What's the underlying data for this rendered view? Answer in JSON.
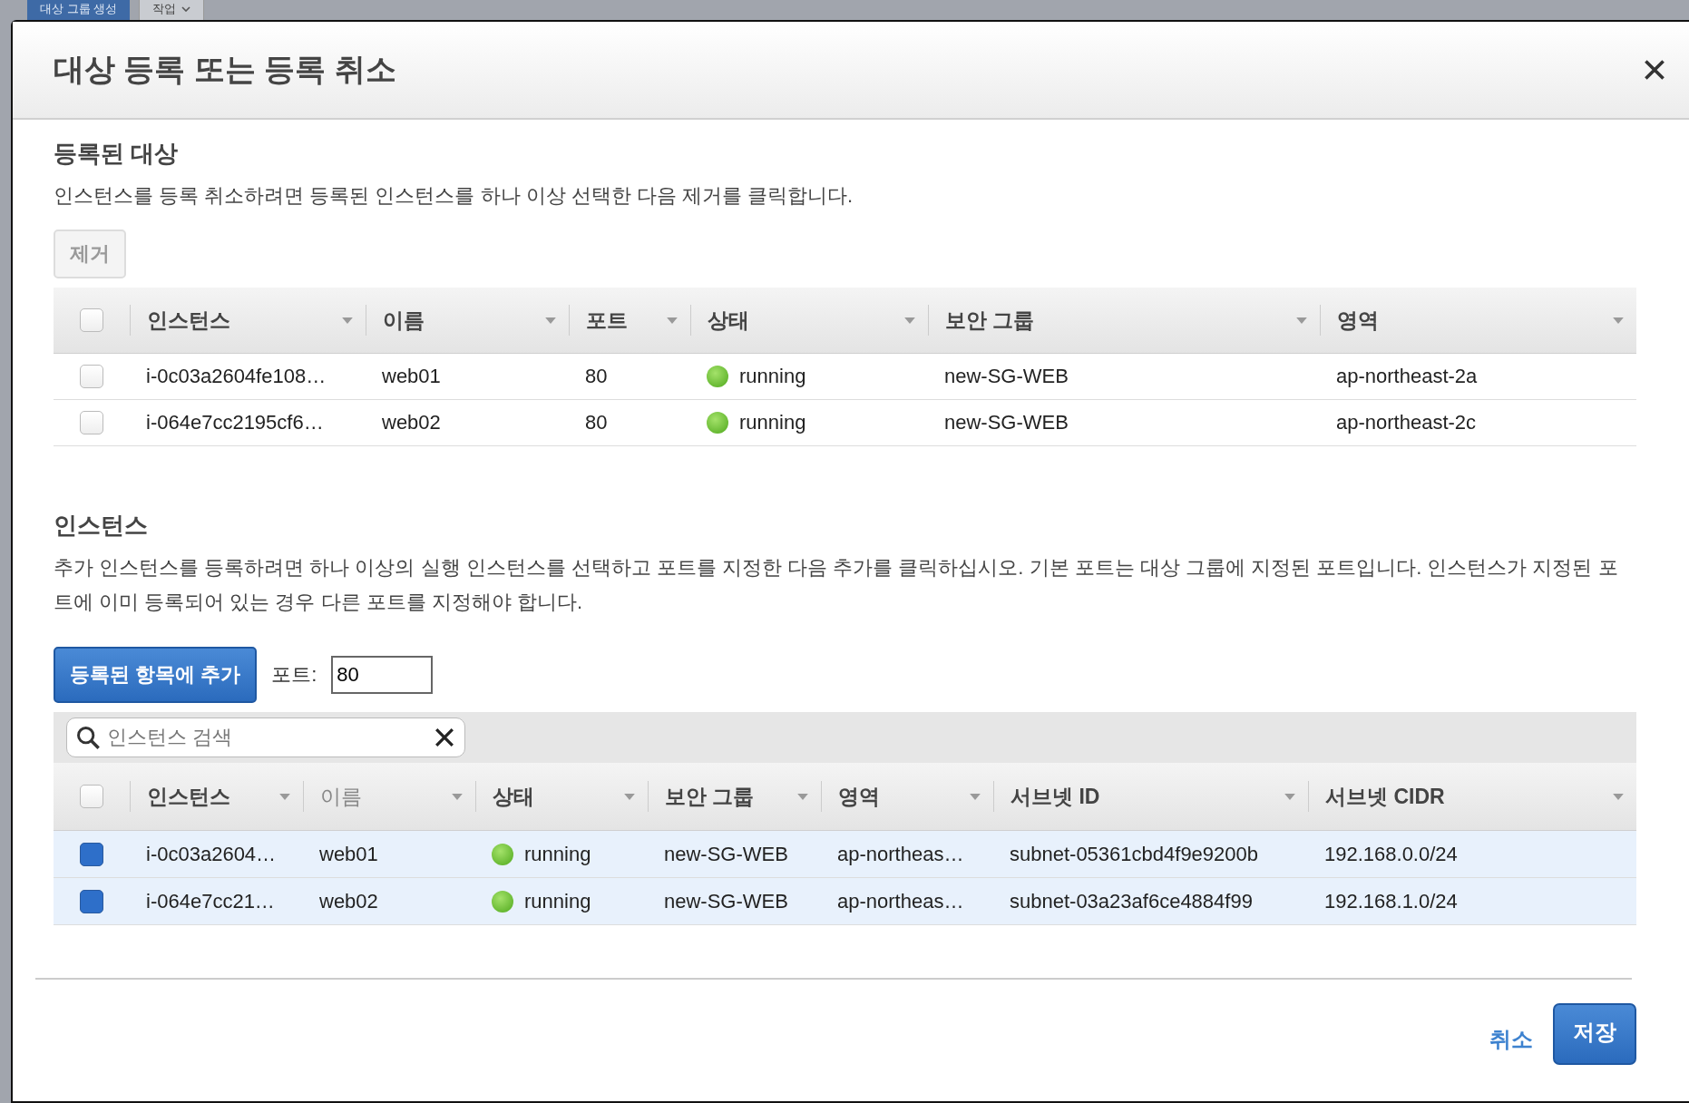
{
  "background_tabs": [
    {
      "label": "대상 그룹 생성",
      "kind": "primary"
    },
    {
      "label": "작업",
      "kind": "menu"
    }
  ],
  "dialog": {
    "title": "대상 등록 또는 등록 취소"
  },
  "registered": {
    "heading": "등록된 대상",
    "description": "인스턴스를 등록 취소하려면 등록된 인스턴스를 하나 이상 선택한 다음 제거를 클릭합니다.",
    "remove_button": {
      "label": "제거",
      "disabled": true
    },
    "select_all_checked": false,
    "columns": [
      {
        "label": "인스턴스"
      },
      {
        "label": "이름"
      },
      {
        "label": "포트"
      },
      {
        "label": "상태"
      },
      {
        "label": "보안 그룹"
      },
      {
        "label": "영역"
      }
    ],
    "rows": [
      {
        "checked": false,
        "cells": [
          "i-0c03a2604fe108…",
          "web01",
          "80",
          "running",
          "new-SG-WEB",
          "ap-northeast-2a"
        ]
      },
      {
        "checked": false,
        "cells": [
          "i-064e7cc2195cf6…",
          "web02",
          "80",
          "running",
          "new-SG-WEB",
          "ap-northeast-2c"
        ]
      }
    ]
  },
  "instances": {
    "heading": "인스턴스",
    "description": "추가 인스턴스를 등록하려면 하나 이상의 실행 인스턴스를 선택하고 포트를 지정한 다음 추가를 클릭하십시오. 기본 포트는 대상 그룹에 지정된 포트입니다. 인스턴스가 지정된 포트에 이미 등록되어 있는 경우 다른 포트를 지정해야 합니다.",
    "add_button": "등록된 항목에 추가",
    "port_label": "포트:",
    "port_value": "80",
    "search": {
      "placeholder": "인스턴스 검색"
    },
    "select_all_checked": false,
    "columns": [
      {
        "label": "인스턴스",
        "muted": false
      },
      {
        "label": "이름",
        "muted": true
      },
      {
        "label": "상태",
        "muted": false
      },
      {
        "label": "보안 그룹",
        "muted": false
      },
      {
        "label": "영역",
        "muted": false
      },
      {
        "label": "서브넷 ID",
        "muted": false
      },
      {
        "label": "서브넷 CIDR",
        "muted": false
      }
    ],
    "rows": [
      {
        "selected": true,
        "cells": [
          "i-0c03a2604…",
          "web01",
          "running",
          "new-SG-WEB",
          "ap-northeas…",
          "subnet-05361cbd4f9e9200b",
          "192.168.0.0/24"
        ]
      },
      {
        "selected": true,
        "cells": [
          "i-064e7cc21…",
          "web02",
          "running",
          "new-SG-WEB",
          "ap-northeas…",
          "subnet-03a23af6ce4884f99",
          "192.168.1.0/24"
        ]
      }
    ]
  },
  "footer": {
    "cancel": "취소",
    "save": "저장"
  }
}
